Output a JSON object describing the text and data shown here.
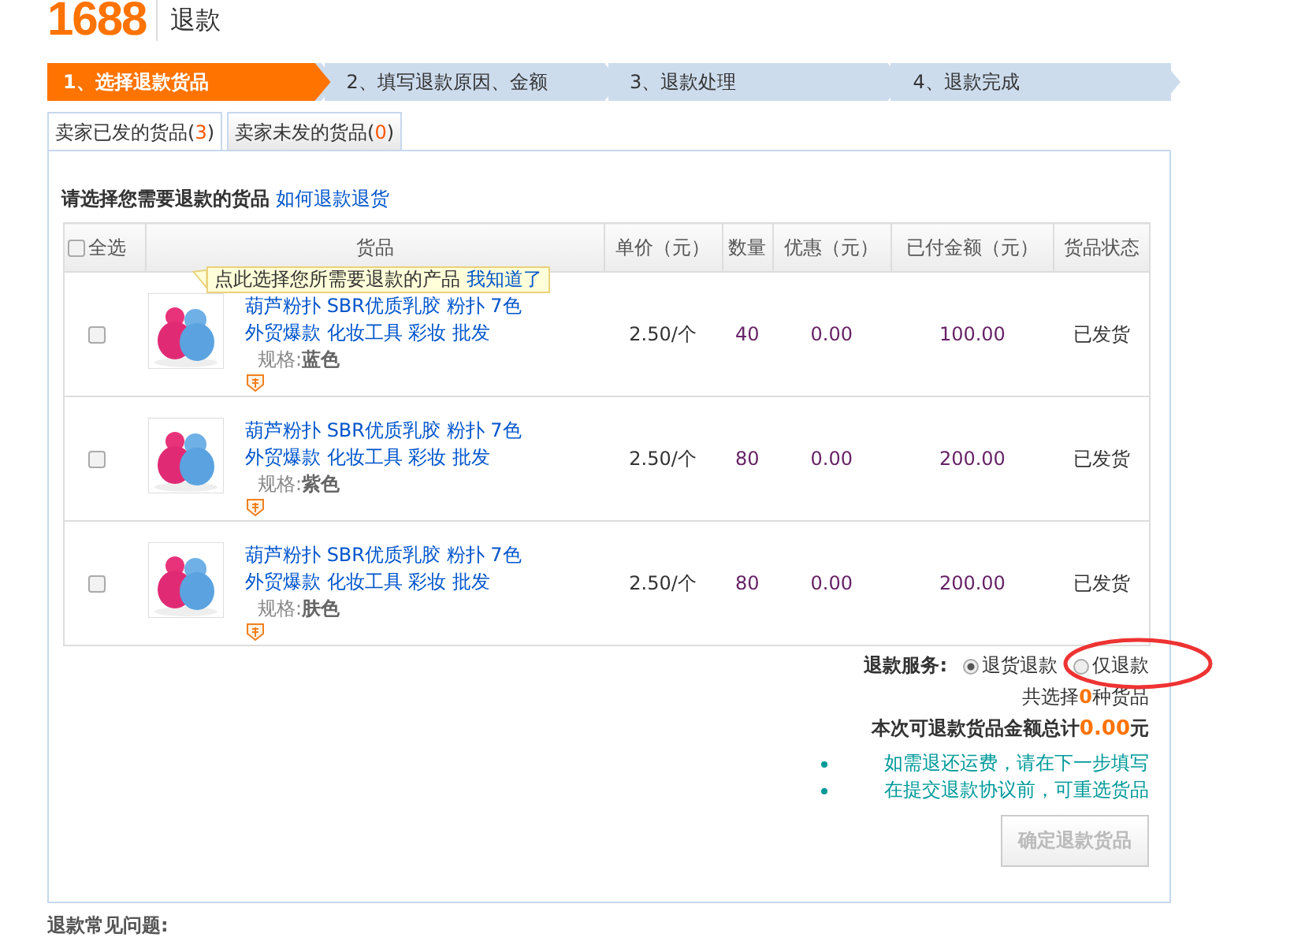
{
  "header": {
    "logo": "1688",
    "title": "退款"
  },
  "steps": [
    {
      "label": "1、选择退款货品",
      "selected": true
    },
    {
      "label": "2、填写退款原因、金额",
      "selected": false
    },
    {
      "label": "3、退款处理",
      "selected": false
    },
    {
      "label": "4、退款完成",
      "selected": false
    }
  ],
  "tabs": [
    {
      "label": "卖家已发的货品(",
      "count": "3",
      "close": ")",
      "selected": true
    },
    {
      "label": "卖家未发的货品(",
      "count": "0",
      "close": ")",
      "selected": false
    }
  ],
  "section": {
    "title": "请选择您需要退款的货品",
    "help_link": "如何退款退货"
  },
  "table": {
    "select_all": {
      "label": "全选",
      "checked": false
    },
    "columns": [
      "货品",
      "单价（元）",
      "数量",
      "优惠（元）",
      "已付金额（元）",
      "货品状态"
    ],
    "rows": [
      {
        "checked": false,
        "name": "葫芦粉扑 SBR优质乳胶 粉扑 7色外贸爆款 化妆工具 彩妆 批发",
        "spec_label": "规格:",
        "spec_value": "蓝色",
        "price": "2.50/个",
        "qty": "40",
        "discount": "0.00",
        "paid": "100.00",
        "status": "已发货"
      },
      {
        "checked": false,
        "name": "葫芦粉扑 SBR优质乳胶 粉扑 7色外贸爆款 化妆工具 彩妆 批发",
        "spec_label": "规格:",
        "spec_value": "紫色",
        "price": "2.50/个",
        "qty": "80",
        "discount": "0.00",
        "paid": "200.00",
        "status": "已发货"
      },
      {
        "checked": false,
        "name": "葫芦粉扑 SBR优质乳胶 粉扑 7色外贸爆款 化妆工具 彩妆 批发",
        "spec_label": "规格:",
        "spec_value": "肤色",
        "price": "2.50/个",
        "qty": "80",
        "discount": "0.00",
        "paid": "200.00",
        "status": "已发货"
      }
    ]
  },
  "tooltip": {
    "text": "点此选择您所需要退款的产品",
    "link": "我知道了"
  },
  "service": {
    "label": "退款服务:",
    "options": [
      {
        "label": "退货退款",
        "selected": true
      },
      {
        "label": "仅退款",
        "selected": false
      }
    ]
  },
  "summary": {
    "count_pre": "共选择",
    "count": "0",
    "count_post": "种货品",
    "total_pre": "本次可退款货品金额总计",
    "total": "0.00",
    "total_post": "元"
  },
  "notes": [
    "如需退还运费，请在下一步填写",
    "在提交退款协议前，可重选货品"
  ],
  "confirm_button": {
    "label": "确定退款货品",
    "disabled": true
  },
  "faq_title": "退款常见问题:"
}
